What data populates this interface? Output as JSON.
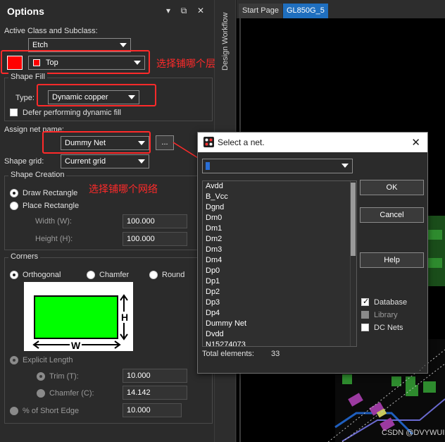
{
  "options": {
    "title": "Options",
    "active_class_label": "Active Class and Subclass:",
    "class_value": "Etch",
    "subclass_value": "Top",
    "shape_fill": {
      "group_label": "Shape Fill",
      "type_label": "Type:",
      "type_value": "Dynamic copper",
      "defer_label": "Defer performing dynamic fill"
    },
    "assign_net_label": "Assign net name:",
    "net_value": "Dummy Net",
    "browse_label": "...",
    "shape_grid_label": "Shape grid:",
    "shape_grid_value": "Current grid",
    "shape_creation": {
      "group_label": "Shape Creation",
      "draw_rect": "Draw Rectangle",
      "place_rect": "Place Rectangle",
      "width_label": "Width (W):",
      "width_value": "100.000",
      "height_label": "Height (H):",
      "height_value": "100.000"
    },
    "corners": {
      "group_label": "Corners",
      "orthogonal": "Orthogonal",
      "chamfer": "Chamfer",
      "round": "Round",
      "diagram_h": "H",
      "diagram_w": "W",
      "explicit_length": "Explicit Length",
      "trim_label": "Trim (T):",
      "trim_value": "10.000",
      "chamfer_label": "Chamfer (C):",
      "chamfer_value": "14.142",
      "short_edge_label": "% of Short Edge",
      "short_edge_value": "10.000"
    }
  },
  "annotations": {
    "layer": "选择铺哪个层",
    "net": "选择铺哪个网络"
  },
  "workflow_label": "Design Workflow",
  "tabs": [
    "Start Page",
    "GL850G_5"
  ],
  "dialog": {
    "title": "Select a net.",
    "filter_value": "",
    "ok": "OK",
    "cancel": "Cancel",
    "help": "Help",
    "nets": [
      "Avdd",
      "B_Vcc",
      "Dgnd",
      "Dm0",
      "Dm1",
      "Dm2",
      "Dm3",
      "Dm4",
      "Dp0",
      "Dp1",
      "Dp2",
      "Dp3",
      "Dp4",
      "Dummy Net",
      "Dvdd",
      "N15274073"
    ],
    "filters": [
      {
        "label": "Database",
        "checked": true
      },
      {
        "label": "Library",
        "checked": false
      },
      {
        "label": "DC Nets",
        "checked": false
      }
    ],
    "total_label": "Total elements:",
    "total_value": "33"
  },
  "watermark": "CSDN @DVYWUI",
  "colors": {
    "layer_swatch": "#ff0000",
    "highlight_box": "#ff2a2a",
    "rect_fill": "#00ff00",
    "active_tab": "#1f6fbf"
  }
}
